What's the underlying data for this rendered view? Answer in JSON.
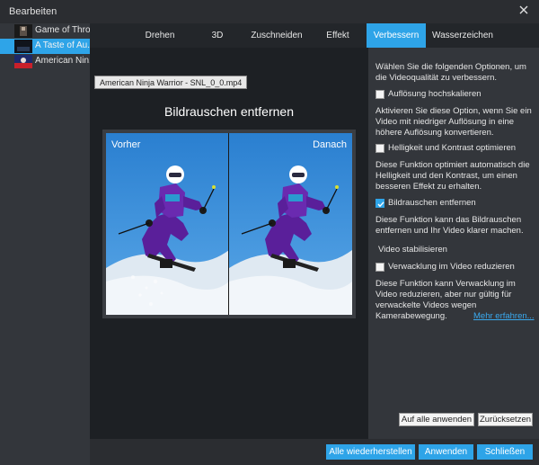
{
  "window": {
    "title": "Bearbeiten"
  },
  "files": [
    {
      "name": "Game of Thro..."
    },
    {
      "name": "A Taste of Au..."
    },
    {
      "name": "American Nin..."
    }
  ],
  "tabs": [
    "Drehen",
    "3D",
    "Zuschneiden",
    "Effekt",
    "Verbessern",
    "Wasserzeichen"
  ],
  "active_tab": "Verbessern",
  "tooltip": "American Ninja Warrior - SNL_0_0.mp4",
  "preview": {
    "title": "Bildrauschen entfernen",
    "before_label": "Vorher",
    "after_label": "Danach"
  },
  "enhance": {
    "intro": "Wählen Sie die folgenden Optionen, um die Videoqualität zu verbessern.",
    "options": [
      {
        "label": "Auflösung hochskalieren",
        "checked": false,
        "desc": "Aktivieren Sie diese Option, wenn Sie ein Video mit niedriger Auflösung in eine höhere Auflösung konvertieren."
      },
      {
        "label": "Helligkeit und Kontrast optimieren",
        "checked": false,
        "desc": "Diese Funktion optimiert automatisch die Helligkeit und den Kontrast, um einen besseren Effekt zu erhalten."
      },
      {
        "label": "Bildrauschen entfernen",
        "checked": true,
        "desc": "Diese Funktion kann das Bildrauschen entfernen und Ihr Video klarer machen."
      }
    ],
    "stabilize_heading": "Video stabilisieren",
    "shake": {
      "label": "Verwacklung im Video reduzieren",
      "checked": false,
      "desc": "Diese Funktion kann Verwacklung im Video reduzieren, aber nur gültig für verwackelte Videos wegen Kamerabewegung."
    },
    "more_link": "Mehr erfahren...",
    "apply_all": "Auf alle anwenden",
    "reset": "Zurücksetzen"
  },
  "footer": {
    "restore_all": "Alle wiederherstellen",
    "apply": "Anwenden",
    "close": "Schließen"
  },
  "colors": {
    "accent": "#2ea4e8",
    "background": "#1d2024",
    "panel": "#33363b"
  }
}
